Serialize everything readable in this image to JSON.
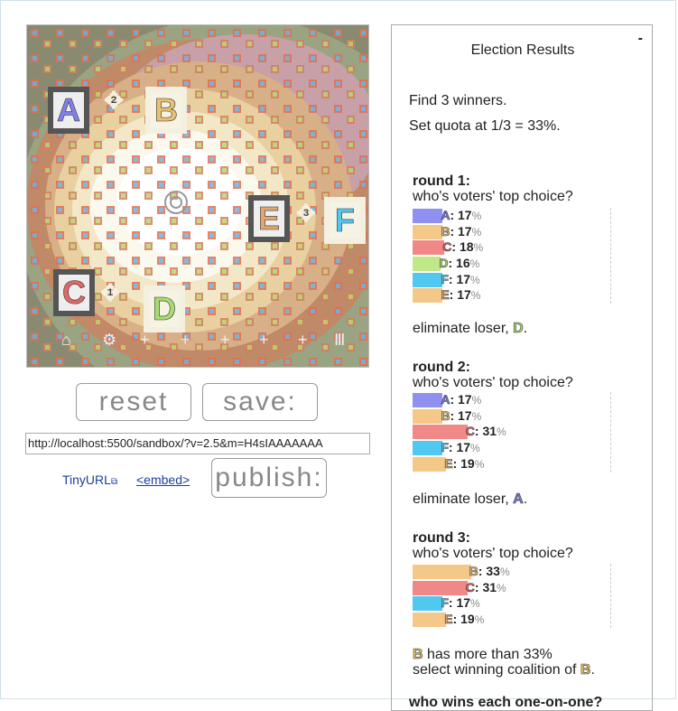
{
  "sim": {
    "candidates": [
      {
        "label": "A",
        "color": "#8080e8"
      },
      {
        "label": "B",
        "color": "#e8c070"
      },
      {
        "label": "C",
        "color": "#e06868"
      },
      {
        "label": "D",
        "color": "#a8dc70"
      },
      {
        "label": "E",
        "color": "#e0a870"
      },
      {
        "label": "F",
        "color": "#50c8f0"
      }
    ],
    "voter_labels": [
      "2",
      "3",
      "1"
    ],
    "toolbar": [
      "voter-tool",
      "gear-tool",
      "add-candidate-tool",
      "add-voter-tool",
      "add-crowd-tool",
      "add-grid-tool",
      "add-distribution-tool",
      "trash-tool"
    ]
  },
  "controls": {
    "reset_label": "reset",
    "save_label": "save:",
    "url_value": "http://localhost:5500/sandbox/?v=2.5&m=H4sIAAAAAAA",
    "tinyurl_label": "TinyURL",
    "embed_label": "<embed>",
    "publish_label": "publish:"
  },
  "results": {
    "title": "Election Results",
    "minimize": "-",
    "find_text": "Find 3 winners.",
    "quota_text": "Set quota at 1/3 = 33%.",
    "rounds": [
      {
        "heading": "round 1:",
        "question": "who's voters' top choice?",
        "bars": [
          {
            "label": "A",
            "value": "17",
            "color": "#9090f0"
          },
          {
            "label": "B",
            "value": "17",
            "color": "#f4c888"
          },
          {
            "label": "C",
            "value": "18",
            "color": "#f08888"
          },
          {
            "label": "D",
            "value": "16",
            "color": "#c0e888"
          },
          {
            "label": "F",
            "value": "17",
            "color": "#50c8f0"
          },
          {
            "label": "E",
            "value": "17",
            "color": "#f4c888"
          }
        ],
        "outcome_pre": "eliminate loser, ",
        "outcome_cand": "D",
        "outcome_post": "."
      },
      {
        "heading": "round 2:",
        "question": "who's voters' top choice?",
        "bars": [
          {
            "label": "A",
            "value": "17",
            "color": "#9090f0"
          },
          {
            "label": "B",
            "value": "17",
            "color": "#f4c888"
          },
          {
            "label": "C",
            "value": "31",
            "color": "#f08888"
          },
          {
            "label": "F",
            "value": "17",
            "color": "#50c8f0"
          },
          {
            "label": "E",
            "value": "19",
            "color": "#f4c888"
          }
        ],
        "outcome_pre": "eliminate loser, ",
        "outcome_cand": "A",
        "outcome_post": "."
      },
      {
        "heading": "round 3:",
        "question": "who's voters' top choice?",
        "bars": [
          {
            "label": "B",
            "value": "33",
            "color": "#f4c888"
          },
          {
            "label": "C",
            "value": "31",
            "color": "#f08888"
          },
          {
            "label": "F",
            "value": "17",
            "color": "#50c8f0"
          },
          {
            "label": "E",
            "value": "19",
            "color": "#f4c888"
          }
        ],
        "outcome_line1_cand": "B",
        "outcome_line1": " has more than 33%",
        "outcome_line2": "select winning coalition of ",
        "outcome_line2_cand": "B",
        "outcome_post": "."
      }
    ],
    "pct_sign": "%",
    "cutoff_text": "who wins each one-on-one?"
  }
}
